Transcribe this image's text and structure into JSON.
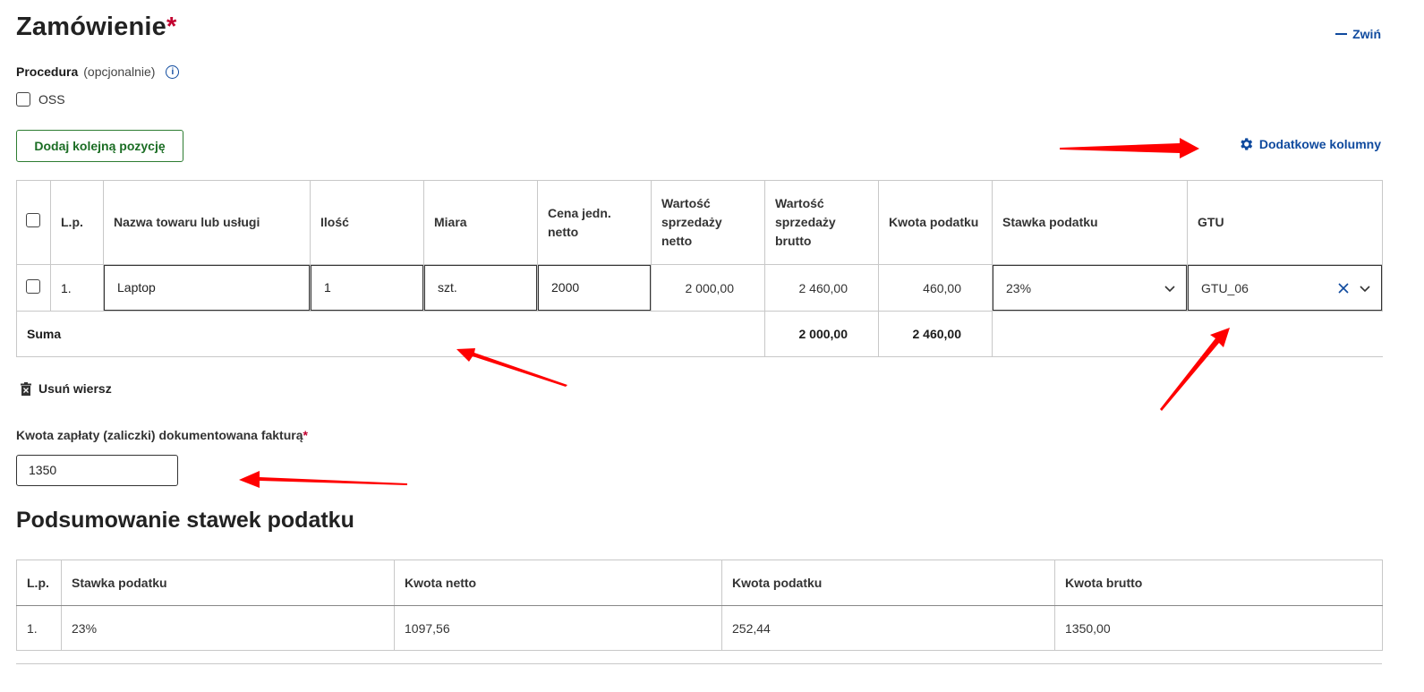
{
  "section": {
    "title": "Zamówienie",
    "required_mark": "*",
    "collapse_label": "Zwiń"
  },
  "procedure": {
    "label": "Procedura",
    "optional": "(opcjonalnie)",
    "checkbox_label": "OSS"
  },
  "buttons": {
    "add_position": "Dodaj kolejną pozycję",
    "extra_columns": "Dodatkowe kolumny",
    "delete_row": "Usuń wiersz"
  },
  "items_table": {
    "headers": [
      "L.p.",
      "Nazwa towaru lub usługi",
      "Ilość",
      "Miara",
      "Cena jedn. netto",
      "Wartość sprzedaży netto",
      "Wartość sprzedaży brutto",
      "Kwota podatku",
      "Stawka podatku",
      "GTU"
    ],
    "rows": [
      {
        "lp": "1.",
        "name": "Laptop",
        "qty": "1",
        "unit": "szt.",
        "price": "2000",
        "net": "2 000,00",
        "gross": "2 460,00",
        "tax": "460,00",
        "rate": "23%",
        "gtu": "GTU_06"
      }
    ],
    "sum": {
      "label": "Suma",
      "net": "2 000,00",
      "gross": "2 460,00"
    }
  },
  "payment": {
    "label": "Kwota zapłaty (zaliczki) dokumentowana fakturą",
    "required_mark": "*",
    "value": "1350"
  },
  "summary": {
    "title": "Podsumowanie stawek podatku",
    "headers": [
      "L.p.",
      "Stawka podatku",
      "Kwota netto",
      "Kwota podatku",
      "Kwota brutto"
    ],
    "rows": [
      {
        "lp": "1.",
        "rate": "23%",
        "net": "1097,56",
        "tax": "252,44",
        "gross": "1350,00"
      }
    ]
  },
  "colors": {
    "accent": "#0f4a9e",
    "success": "#2e7d32",
    "required": "#c2002f",
    "annotation": "#ff0000"
  },
  "icons": [
    "info-icon",
    "gear-icon",
    "chevron-down-icon",
    "clear-icon",
    "trash-icon",
    "minus-icon"
  ]
}
